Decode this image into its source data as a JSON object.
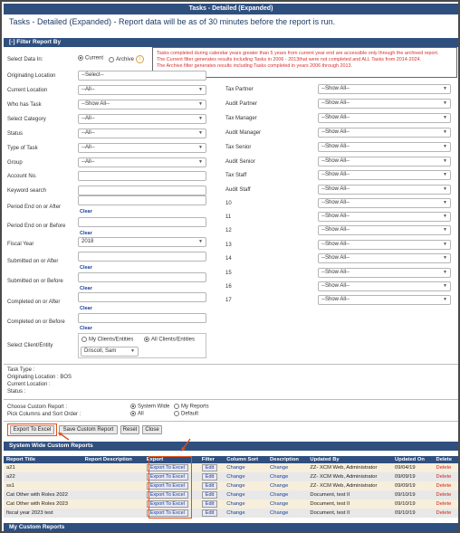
{
  "window_title": "Tasks - Detailed (Expanded)",
  "subtitle": "Tasks - Detailed (Expanded) - Report data will be as of 30 minutes before the report is run.",
  "filter_header": "[-] Filter Report By",
  "tooltip": {
    "line1": "Tasks completed during calendar years greater than 5 years from current year end are accessible only through the archived report.",
    "line2": "The Current filter generates results including Tasks in 2006 - 2013that were not completed and ALL Tasks from 2014-2024.",
    "line3": "The Archive filter generates results including Tasks completed in years 2006 through 2013."
  },
  "select_data": {
    "label": "Select Data In:",
    "current": "Current",
    "archive": "Archive",
    "info": "i"
  },
  "left_fields": {
    "originating_location": {
      "label": "Originating Location",
      "value": "--Select--"
    },
    "current_location": {
      "label": "Current Location",
      "value": "--All--"
    },
    "who_has_task": {
      "label": "Who has Task",
      "value": "--Show All--"
    },
    "select_category": {
      "label": "Select Category",
      "value": "--All--"
    },
    "status": {
      "label": "Status",
      "value": "--All--"
    },
    "type_of_task": {
      "label": "Type of Task",
      "value": "--All--"
    },
    "group": {
      "label": "Group",
      "value": "--All--"
    },
    "account_no": {
      "label": "Account No."
    },
    "keyword_search": {
      "label": "Keyword search"
    },
    "period_end_after": {
      "label": "Period End on or After",
      "clear": "Clear"
    },
    "period_end_before": {
      "label": "Period End on or Before",
      "clear": "Clear"
    },
    "fiscal_year": {
      "label": "Fiscal Year",
      "value": "2018"
    },
    "submitted_after": {
      "label": "Submitted on or After",
      "clear": "Clear"
    },
    "submitted_before": {
      "label": "Submitted on or Before",
      "clear": "Clear"
    },
    "completed_after": {
      "label": "Completed on or After",
      "clear": "Clear"
    },
    "completed_before": {
      "label": "Completed on or Before",
      "clear": "Clear"
    },
    "client_entity": {
      "label": "Select Client/Entity",
      "my_clients": "My Clients/Entities",
      "all_clients": "All Clients/Entities",
      "value": "Driscoll, Sam"
    }
  },
  "right_fields": [
    {
      "label": "Tax Partner",
      "value": "--Show All--"
    },
    {
      "label": "Audit Partner",
      "value": "--Show All--"
    },
    {
      "label": "Tax Manager",
      "value": "--Show All--"
    },
    {
      "label": "Audit Manager",
      "value": "--Show All--"
    },
    {
      "label": "Tax Senior",
      "value": "--Show All--"
    },
    {
      "label": "Audit Senior",
      "value": "--Show All--"
    },
    {
      "label": "Tax Staff",
      "value": "--Show All--"
    },
    {
      "label": "Audit Staff",
      "value": "--Show All--"
    },
    {
      "label": "10",
      "value": "--Show All--"
    },
    {
      "label": "11",
      "value": "--Show All--"
    },
    {
      "label": "12",
      "value": "--Show All--"
    },
    {
      "label": "13",
      "value": "--Show All--"
    },
    {
      "label": "14",
      "value": "--Show All--"
    },
    {
      "label": "15",
      "value": "--Show All--"
    },
    {
      "label": "16",
      "value": "--Show All--"
    },
    {
      "label": "17",
      "value": "--Show All--"
    }
  ],
  "summary": {
    "task_type": "Task Type :",
    "originating_location": "Originating Location : BOS",
    "current_location": "Current Location :",
    "status": "Status :"
  },
  "custom_report": {
    "choose_label": "Choose Custom Report :",
    "system_wide": "System Wide",
    "my_reports": "My Reports",
    "pick_label": "Pick Columns and Sort Order :",
    "all": "All",
    "default": "Default"
  },
  "actions": {
    "export": "Export To Excel",
    "save": "Save Custom Report",
    "reset": "Reset",
    "close": "Close"
  },
  "system_wide_header": "System Wide Custom Reports",
  "table": {
    "headers": [
      "Report Title",
      "Report Description",
      "Export",
      "Filter",
      "Column Sort",
      "Description",
      "Updated By",
      "Updated On",
      "Delete"
    ],
    "rows": [
      {
        "title": "a21",
        "export": "Export To Excel",
        "filter": "Edit",
        "sort": "Change",
        "desc": "Change",
        "by": "ZZ- XCM Web, Administrator",
        "on": "09/04/19",
        "del": "Delete"
      },
      {
        "title": "a22",
        "export": "Export To Excel",
        "filter": "Edit",
        "sort": "Change",
        "desc": "Change",
        "by": "ZZ- XCM Web, Administrator",
        "on": "09/09/19",
        "del": "Delete"
      },
      {
        "title": "ss1",
        "export": "Export To Excel",
        "filter": "Edit",
        "sort": "Change",
        "desc": "Change",
        "by": "ZZ- XCM Web, Administrator",
        "on": "09/09/19",
        "del": "Delete"
      },
      {
        "title": "Cat Other with Roles 2022",
        "export": "Export To Excel",
        "filter": "Edit",
        "sort": "Change",
        "desc": "Change",
        "by": "Document, test II",
        "on": "09/10/19",
        "del": "Delete"
      },
      {
        "title": "Cat Other with Roles 2023",
        "export": "Export To Excel",
        "filter": "Edit",
        "sort": "Change",
        "desc": "Change",
        "by": "Document, test II",
        "on": "09/10/19",
        "del": "Delete"
      },
      {
        "title": "fiscal year 2023 test",
        "export": "Export To Excel",
        "filter": "Edit",
        "sort": "Change",
        "desc": "Change",
        "by": "Document, test II",
        "on": "09/10/19",
        "del": "Delete"
      }
    ]
  },
  "my_custom_header": "My Custom Reports",
  "colors": {
    "header_bg": "#2f4f7f",
    "highlight": "#e0501a",
    "tooltip_text": "#d83030",
    "link": "#1a3f9a",
    "delete": "#c8251e"
  },
  "icons": {
    "dropdown": "chevron-down-icon",
    "info": "info-icon",
    "annotation": "arrow-icon"
  }
}
